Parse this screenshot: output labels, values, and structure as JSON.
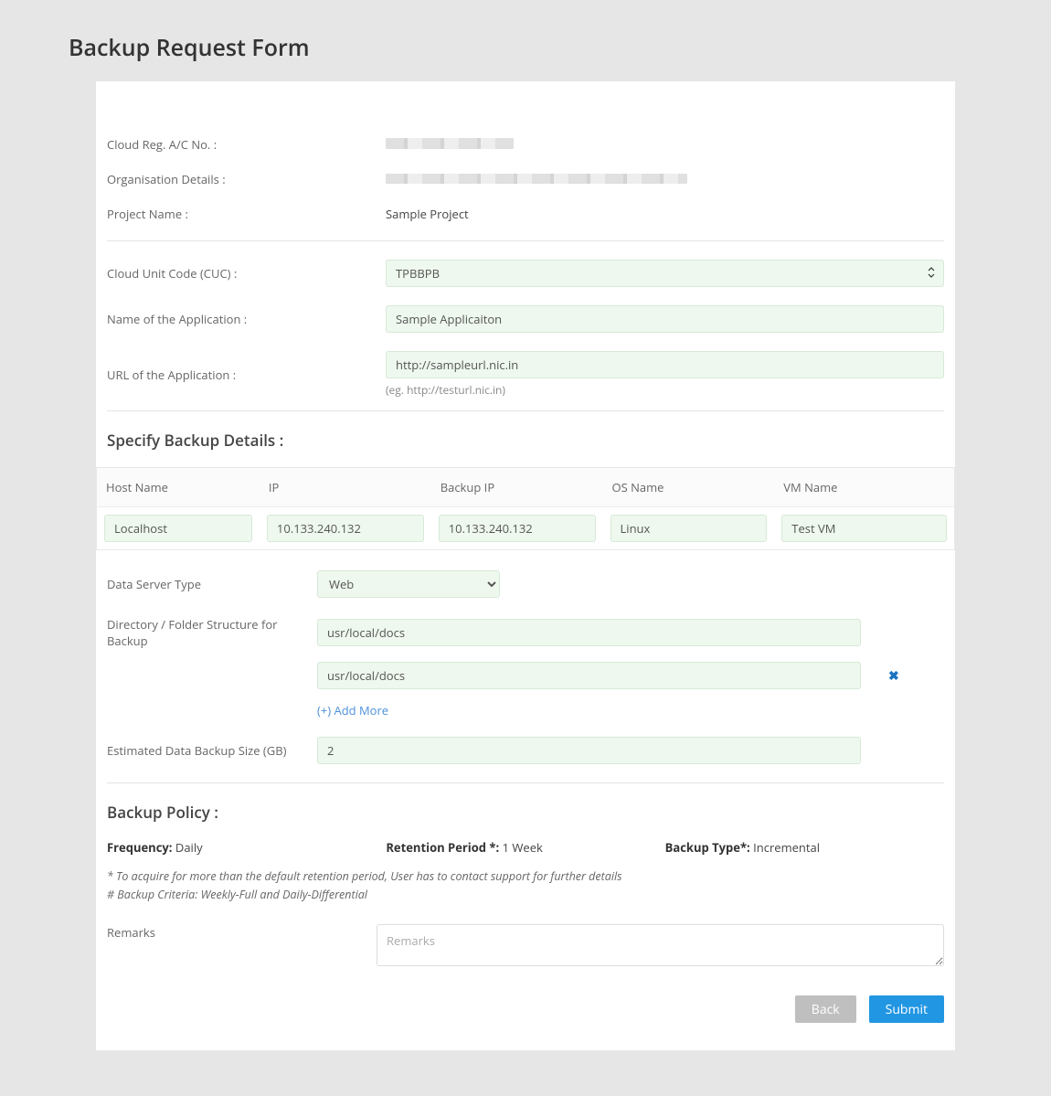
{
  "title": "Backup Request Form",
  "labels": {
    "cloud_reg": "Cloud Reg. A/C No. :",
    "org_details": "Organisation Details :",
    "project_name": "Project Name :",
    "cuc": "Cloud Unit Code (CUC) :",
    "app_name": "Name of the Application :",
    "app_url": "URL of the Application :",
    "url_hint": "(eg. http://testurl.nic.in)",
    "backup_details_header": "Specify Backup Details :",
    "data_server_type": "Data Server Type",
    "dir_structure": "Directory / Folder Structure for Backup",
    "add_more": "(+) Add More",
    "est_size": "Estimated Data Backup Size (GB)",
    "backup_policy_header": "Backup Policy :",
    "frequency_label": "Frequency:",
    "retention_label": "Retention Period *:",
    "backup_type_label": "Backup Type*:",
    "note1": "* To acquire for more than the default retention period, User has to contact support for further details",
    "note2": "# Backup Criteria: Weekly-Full and Daily-Differential",
    "remarks": "Remarks",
    "remarks_placeholder": "Remarks",
    "back": "Back",
    "submit": "Submit"
  },
  "values": {
    "project_name": "Sample Project",
    "cuc_selected": "TPBBPB",
    "app_name": "Sample Applicaiton",
    "app_url": "http://sampleurl.nic.in",
    "data_server_type": "Web",
    "dir1": "usr/local/docs",
    "dir2": "usr/local/docs",
    "est_size": "2",
    "frequency": "Daily",
    "retention": "1 Week",
    "backup_type": "Incremental"
  },
  "table": {
    "headers": {
      "host": "Host Name",
      "ip": "IP",
      "backup_ip": "Backup IP",
      "os": "OS Name",
      "vm": "VM Name"
    },
    "row": {
      "host": "Localhost",
      "ip": "10.133.240.132",
      "backup_ip": "10.133.240.132",
      "os": "Linux",
      "vm": "Test VM"
    }
  }
}
